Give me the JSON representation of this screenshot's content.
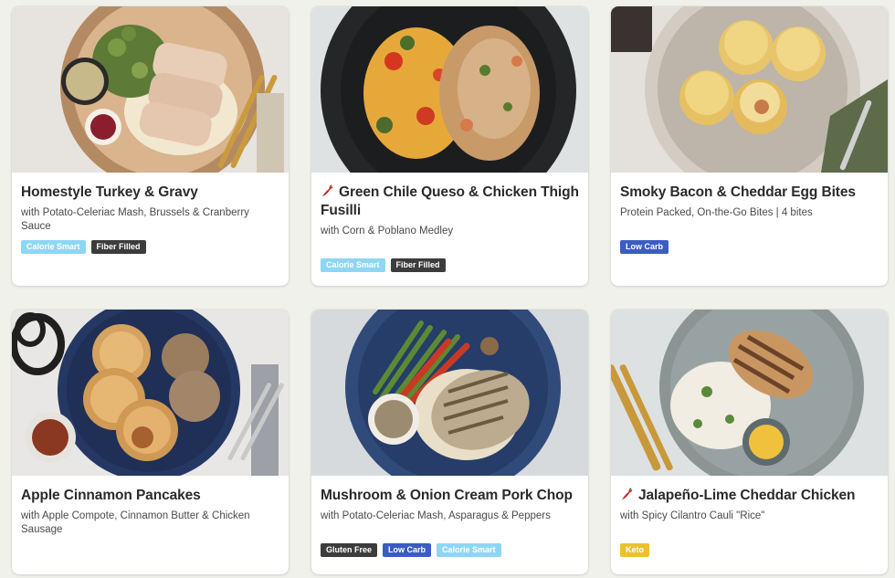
{
  "colors": {
    "page_bg": "#f1f1ec",
    "tag_calorie_smart": "#8fd6f4",
    "tag_fiber_filled": "#3c3c3c",
    "tag_low_carb": "#3b5cc4",
    "tag_gluten_free": "#3c3c3c",
    "tag_keto": "#ecc12f"
  },
  "meals": [
    {
      "title": "Homestyle Turkey & Gravy",
      "subtitle": "with Potato-Celeriac Mash, Brussels & Cranberry Sauce",
      "spicy": false,
      "tags": [
        {
          "label": "Calorie Smart",
          "color": "#8fd6f4"
        },
        {
          "label": "Fiber Filled",
          "color": "#3c3c3c"
        }
      ]
    },
    {
      "title": "Green Chile Queso & Chicken Thigh Fusilli",
      "subtitle": "with Corn & Poblano Medley",
      "spicy": true,
      "tags": [
        {
          "label": "Calorie Smart",
          "color": "#8fd6f4"
        },
        {
          "label": "Fiber Filled",
          "color": "#3c3c3c"
        }
      ]
    },
    {
      "title": "Smoky Bacon & Cheddar Egg Bites",
      "subtitle": "Protein Packed, On-the-Go Bites | 4 bites",
      "spicy": false,
      "tags": [
        {
          "label": "Low Carb",
          "color": "#3b5cc4"
        }
      ]
    },
    {
      "title": "Apple Cinnamon Pancakes",
      "subtitle": "with Apple Compote, Cinnamon Butter & Chicken Sausage",
      "spicy": false,
      "tags": []
    },
    {
      "title": "Mushroom & Onion Cream Pork Chop",
      "subtitle": "with Potato-Celeriac Mash, Asparagus & Peppers",
      "spicy": false,
      "tags": [
        {
          "label": "Gluten Free",
          "color": "#3c3c3c"
        },
        {
          "label": "Low Carb",
          "color": "#3b5cc4"
        },
        {
          "label": "Calorie Smart",
          "color": "#8fd6f4"
        }
      ]
    },
    {
      "title": "Jalapeño-Lime Cheddar Chicken",
      "subtitle": "with Spicy Cilantro Cauli \"Rice\"",
      "spicy": true,
      "tags": [
        {
          "label": "Keto",
          "color": "#ecc12f"
        }
      ]
    }
  ]
}
